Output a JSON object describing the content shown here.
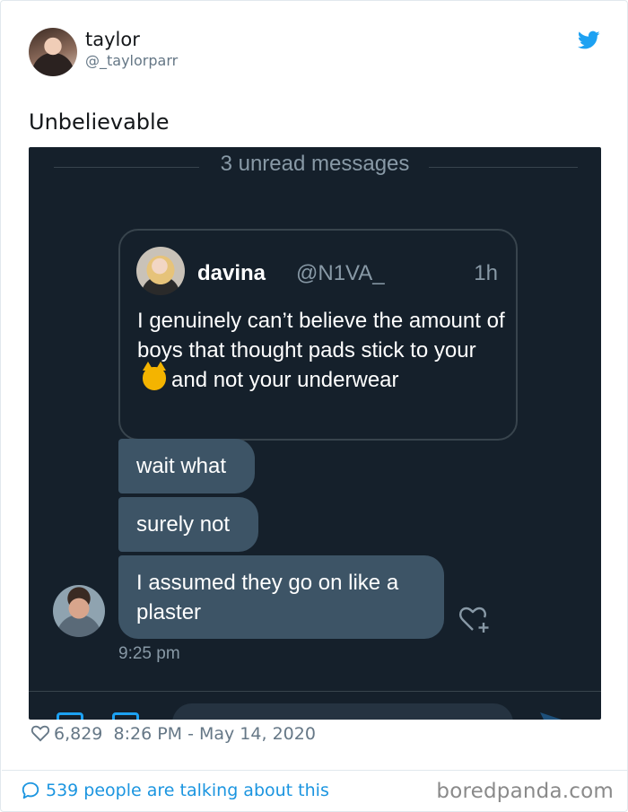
{
  "tweet": {
    "author": {
      "name": "taylor",
      "handle": "@_taylorparr"
    },
    "text": "Unbelievable",
    "likes": "6,829",
    "timestamp": "8:26 PM - May 14, 2020",
    "talking": "539 people are talking about this"
  },
  "dm": {
    "unread_label": "3 unread messages",
    "quoted_tweet": {
      "name": "davina",
      "handle": "@N1VA_",
      "time": "1h",
      "text_part1": "I genuinely can’t believe the amount of boys that thought pads stick to your",
      "emoji": "cat-face-emoji",
      "text_part2": "and not your underwear"
    },
    "messages": [
      {
        "text": "wait what"
      },
      {
        "text": "surely not"
      },
      {
        "text": "I assumed they go on like a plaster"
      }
    ],
    "message_time": "9:25 pm"
  },
  "watermark": "boredpanda.com",
  "icons": {
    "brand": "twitter-bird-icon",
    "like": "heart-outline-icon",
    "reply": "speech-bubble-icon",
    "react": "heart-add-icon"
  },
  "colors": {
    "twitter_blue": "#1da1f2",
    "dark_bg": "#15202b",
    "bubble": "#3d5466",
    "muted": "#8899a6"
  }
}
